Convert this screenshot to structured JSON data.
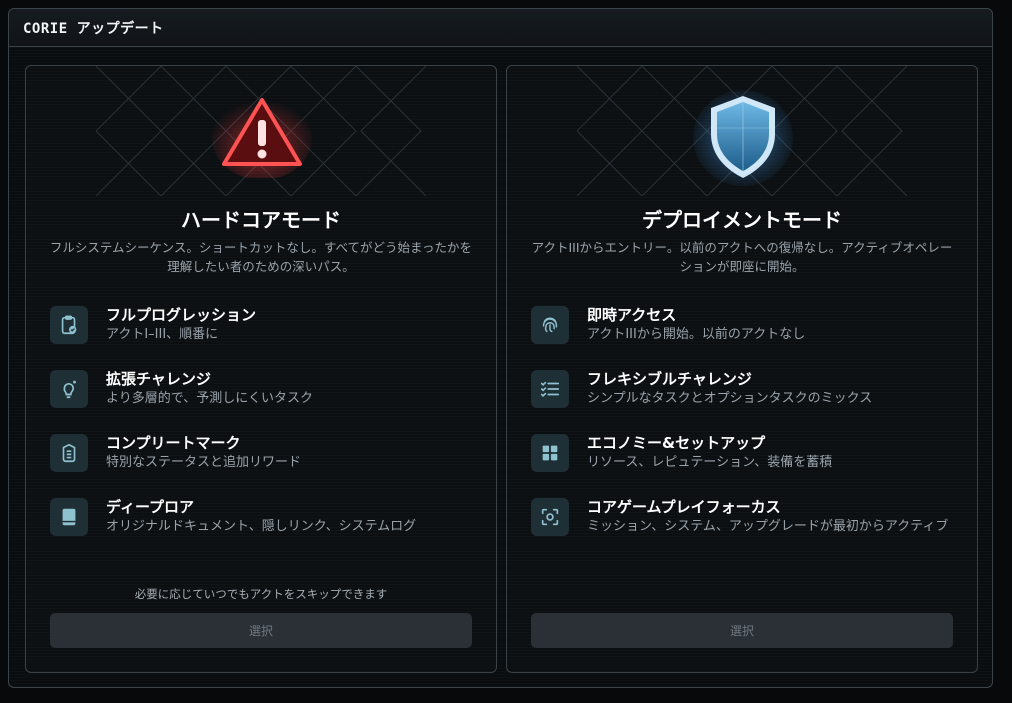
{
  "window": {
    "title": "CORIE アップデート"
  },
  "colors": {
    "hardcore_accent": "#e84a4a",
    "deploy_accent": "#5aa6d8",
    "icon_tile": "#1f2f36",
    "icon_glyph": "#8fc2cf"
  },
  "hardcore": {
    "emblem": "warning-triangle-icon",
    "title": "ハードコアモード",
    "description": "フルシステムシーケンス。ショートカットなし。すべてがどう始まったかを理解したい者のための深いパス。",
    "features": [
      {
        "icon": "clipboard-check-icon",
        "name": "フルプログレッション",
        "sub": "アクトI–III、順番に"
      },
      {
        "icon": "lightbulb-spark-icon",
        "name": "拡張チャレンジ",
        "sub": "より多層的で、予測しにくいタスク"
      },
      {
        "icon": "badge-list-icon",
        "name": "コンプリートマーク",
        "sub": "特別なステータスと追加リワード"
      },
      {
        "icon": "book-icon",
        "name": "ディープロア",
        "sub": "オリジナルドキュメント、隠しリンク、システムログ"
      }
    ],
    "skip_note": "必要に応じていつでもアクトをスキップできます",
    "select_label": "選択"
  },
  "deploy": {
    "emblem": "shield-icon",
    "title": "デプロイメントモード",
    "description": "アクトIIIからエントリー。以前のアクトへの復帰なし。アクティブオペレーションが即座に開始。",
    "features": [
      {
        "icon": "fingerprint-icon",
        "name": "即時アクセス",
        "sub": "アクトIIIから開始。以前のアクトなし"
      },
      {
        "icon": "checklist-icon",
        "name": "フレキシブルチャレンジ",
        "sub": "シンプルなタスクとオプションタスクのミックス"
      },
      {
        "icon": "grid-icon",
        "name": "エコノミー&セットアップ",
        "sub": "リソース、レピュテーション、装備を蓄積"
      },
      {
        "icon": "focus-scan-icon",
        "name": "コアゲームプレイフォーカス",
        "sub": "ミッション、システム、アップグレードが最初からアクティブ"
      }
    ],
    "select_label": "選択"
  }
}
